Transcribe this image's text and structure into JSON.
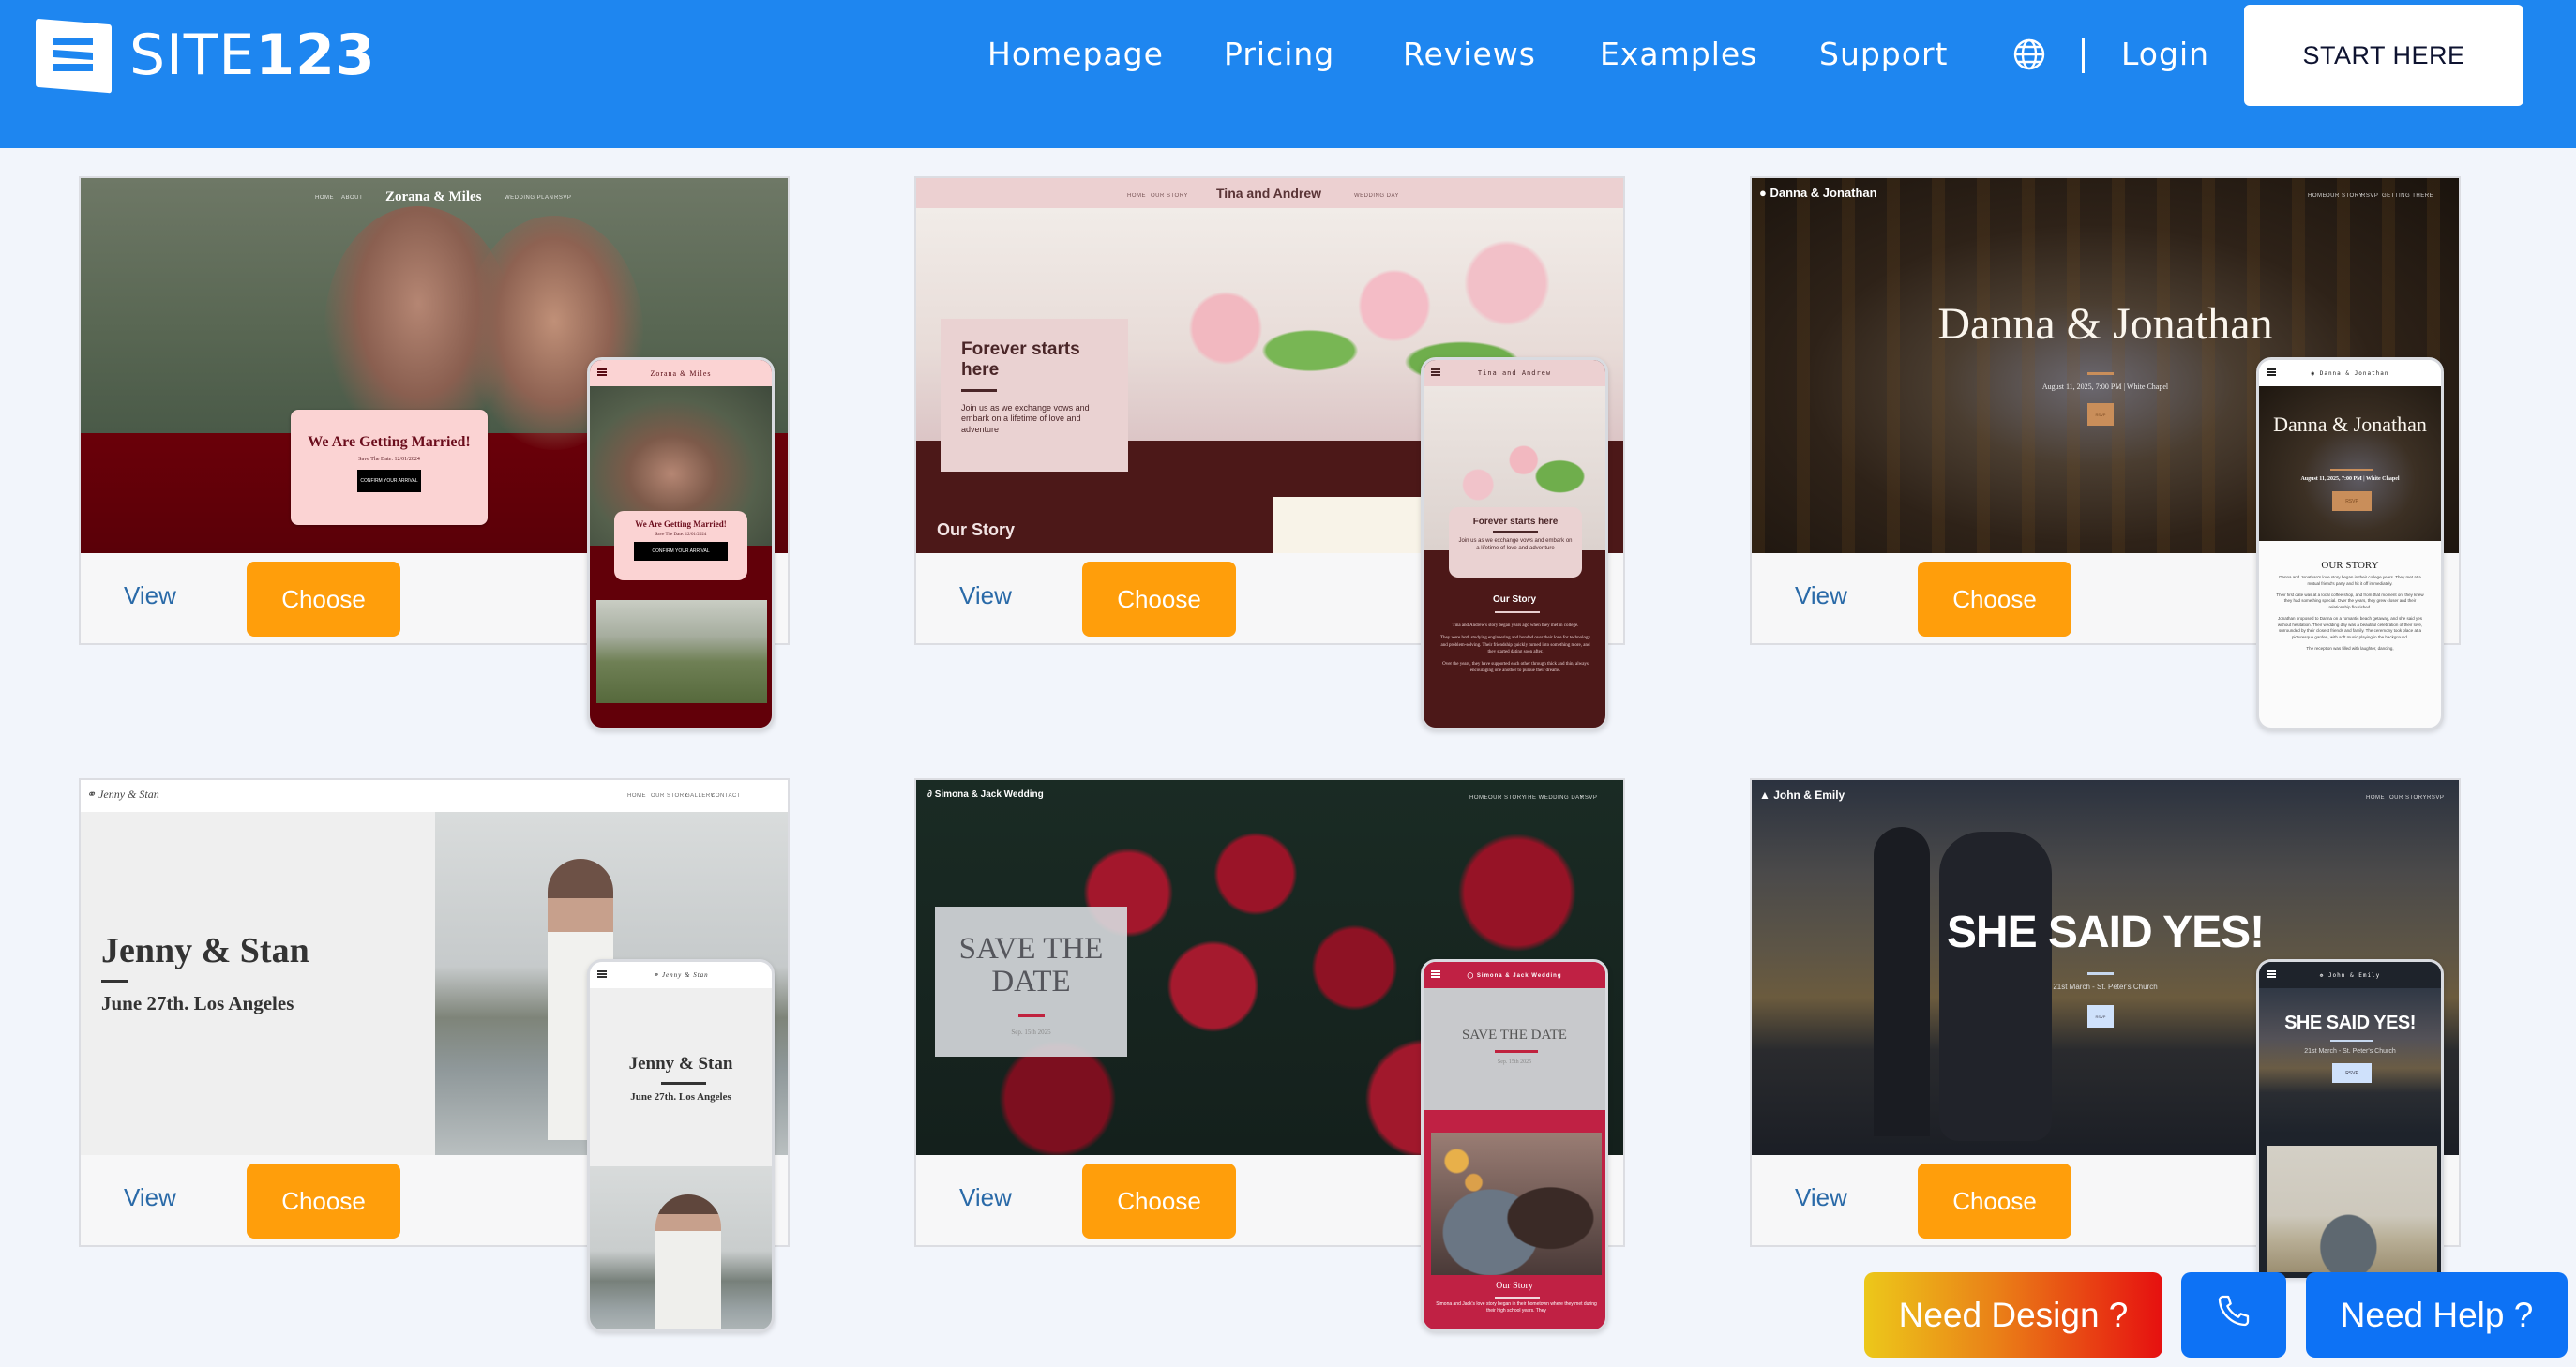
{
  "header": {
    "logo_word": "SITE",
    "logo_number": "123",
    "nav": [
      "Homepage",
      "Pricing",
      "Reviews",
      "Examples",
      "Support"
    ],
    "language_icon": "globe-icon",
    "login": "Login",
    "cta": "START HERE"
  },
  "colors": {
    "brand_blue": "#1e86f0",
    "choose_orange": "#ff9e0b",
    "view_link": "#2a6aa8",
    "help_blue": "#0d72f5"
  },
  "card_actions": {
    "view": "View",
    "choose": "Choose"
  },
  "templates": [
    {
      "name": "Zorana & Miles",
      "desktop": {
        "menu_left": [
          "HOME",
          "ABOUT"
        ],
        "menu_right": [
          "WEDDING PLAN",
          "RSVP"
        ],
        "headline": "We Are Getting Married!",
        "subline": "Save The Date: 12/01/2024",
        "button": "CONFIRM YOUR ARRIVAL"
      },
      "mobile": {
        "title": "Zorana & Miles",
        "headline": "We Are Getting Married!",
        "subline": "Save The Date: 12/01/2024",
        "button": "CONFIRM YOUR ARRIVAL"
      }
    },
    {
      "name": "Tina and Andrew",
      "desktop": {
        "menu_left": [
          "HOME",
          "OUR STORY"
        ],
        "menu_right": [
          "WEDDING DAY"
        ],
        "headline": "Forever starts here",
        "body": "Join us as we exchange vows and embark on a lifetime of love and adventure",
        "section": "Our Story"
      },
      "mobile": {
        "title": "Tina and Andrew",
        "headline": "Forever starts here",
        "body": "Join us as we exchange vows and embark on a lifetime of love and adventure",
        "section": "Our Story",
        "story": [
          "Tina and Andrew's story began years ago when they met in college.",
          "They were both studying engineering and bonded over their love for technology and problem-solving. Their friendship quickly turned into something more, and they started dating soon after.",
          "Over the years, they have supported each other through thick and thin, always encouraging one another to pursue their dreams."
        ]
      }
    },
    {
      "name": "Danna & Jonathan",
      "desktop": {
        "menu_right": [
          "HOME",
          "OUR STORY",
          "RSVP",
          "GETTING THERE"
        ],
        "headline": "Danna & Jonathan",
        "subline": "August 11, 2025, 7:00 PM | White Chapel",
        "button": "RSVP"
      },
      "mobile": {
        "title": "Danna & Jonathan",
        "headline": "Danna & Jonathan",
        "subline": "August 11, 2025, 7:00 PM | White Chapel",
        "button": "RSVP",
        "section": "OUR STORY",
        "story": [
          "Danna and Jonathan's love story began in their college years. They met at a mutual friend's party and hit it off immediately.",
          "Their first date was at a local coffee shop, and from that moment on, they knew they had something special. Over the years, they grew closer and their relationship flourished.",
          "Jonathan proposed to Danna on a romantic beach getaway, and she said yes without hesitation. Their wedding day was a beautiful celebration of their love, surrounded by their closest friends and family. The ceremony took place at a picturesque garden, with soft music playing in the background.",
          "The reception was filled with laughter, dancing,"
        ]
      }
    },
    {
      "name": "Jenny & Stan",
      "desktop": {
        "menu_right": [
          "HOME",
          "OUR STORY",
          "GALLERY",
          "CONTACT"
        ],
        "headline": "Jenny & Stan",
        "subline": "June 27th. Los Angeles"
      },
      "mobile": {
        "title": "Jenny & Stan",
        "headline": "Jenny & Stan",
        "subline": "June 27th. Los Angeles"
      }
    },
    {
      "name": "Simona & Jack Wedding",
      "desktop": {
        "menu_right": [
          "HOME",
          "OUR STORY",
          "THE WEDDING DAY",
          "RSVP"
        ],
        "headline": "SAVE THE DATE",
        "subline": "Sep. 15th 2025"
      },
      "mobile": {
        "title": "Simona & Jack Wedding",
        "headline": "SAVE THE DATE",
        "subline": "Sep. 15th 2025",
        "section": "Our Story",
        "story": "Simona and Jack's love story began in their hometown where they met during their high school years. They"
      }
    },
    {
      "name": "John & Emily",
      "desktop": {
        "menu_right": [
          "HOME",
          "OUR STORY",
          "RSVP"
        ],
        "headline": "SHE SAID YES!",
        "subline": "21st March - St. Peter's Church",
        "button": "RSVP"
      },
      "mobile": {
        "title": "John & Emily",
        "headline": "SHE SAID YES!",
        "subline": "21st March - St. Peter's Church",
        "button": "RSVP"
      }
    }
  ],
  "floating": {
    "design": "Need Design ?",
    "phone_icon": "phone-icon",
    "help": "Need Help ?"
  }
}
